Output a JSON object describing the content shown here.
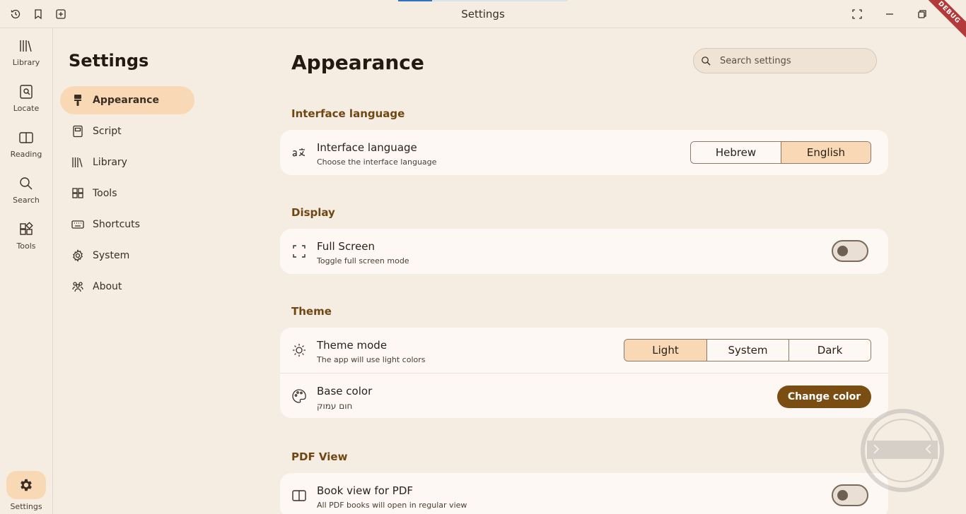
{
  "window": {
    "title": "Settings",
    "debug_label": "DEBUG"
  },
  "rail": {
    "items": [
      {
        "label": "Library",
        "icon": "library-icon"
      },
      {
        "label": "Locate",
        "icon": "locate-icon"
      },
      {
        "label": "Reading",
        "icon": "book-open-icon"
      },
      {
        "label": "Search",
        "icon": "search-icon"
      },
      {
        "label": "Tools",
        "icon": "tools-icon"
      }
    ],
    "settings_label": "Settings"
  },
  "settings_nav": {
    "title": "Settings",
    "items": [
      {
        "label": "Appearance",
        "icon": "paint-brush-icon",
        "active": true
      },
      {
        "label": "Script",
        "icon": "script-icon"
      },
      {
        "label": "Library",
        "icon": "library-icon"
      },
      {
        "label": "Tools",
        "icon": "tools-icon"
      },
      {
        "label": "Shortcuts",
        "icon": "keyboard-icon"
      },
      {
        "label": "System",
        "icon": "gear-icon"
      },
      {
        "label": "About",
        "icon": "people-icon"
      }
    ]
  },
  "main": {
    "title": "Appearance",
    "search": {
      "placeholder": "Search settings"
    },
    "sections": {
      "interface_language": {
        "title": "Interface language",
        "row": {
          "title": "Interface language",
          "subtitle": "Choose the interface language",
          "options": [
            "Hebrew",
            "English"
          ],
          "selected": "English"
        }
      },
      "display": {
        "title": "Display",
        "row": {
          "title": "Full Screen",
          "subtitle": "Toggle full screen mode",
          "enabled": false
        }
      },
      "theme": {
        "title": "Theme",
        "mode_row": {
          "title": "Theme mode",
          "subtitle": "The app will use light colors",
          "options": [
            "Light",
            "System",
            "Dark"
          ],
          "selected": "Light"
        },
        "color_row": {
          "title": "Base color",
          "subtitle": "חום עמוק",
          "button": "Change color"
        }
      },
      "pdf_view": {
        "title": "PDF View",
        "row": {
          "title": "Book view for PDF",
          "subtitle": "All PDF books will open in regular view",
          "enabled": false
        }
      }
    }
  },
  "colors": {
    "background": "#f5ece2",
    "card": "#fdf8f4",
    "accent_light": "#f9d9b5",
    "accent_dark": "#7a4d12",
    "section_title": "#6e4712"
  }
}
